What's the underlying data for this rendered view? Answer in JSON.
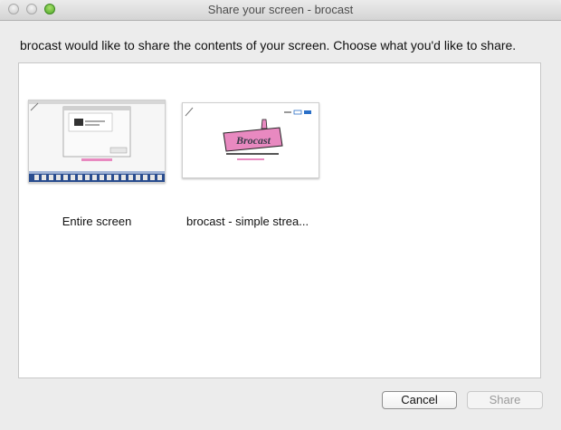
{
  "window": {
    "title": "Share your screen - brocast"
  },
  "prompt": "brocast would like to share the contents of your screen. Choose what you'd like to share.",
  "sources": [
    {
      "label": "Entire screen",
      "icon": "desktop-thumbnail"
    },
    {
      "label": "brocast - simple strea...",
      "icon": "tab-thumbnail",
      "logo_text": "Brocast"
    }
  ],
  "buttons": {
    "cancel": "Cancel",
    "share": "Share"
  },
  "colors": {
    "logo_pink": "#e889c0",
    "dock_blue": "#2a4d8f",
    "zoom_green": "#4ea82a"
  }
}
